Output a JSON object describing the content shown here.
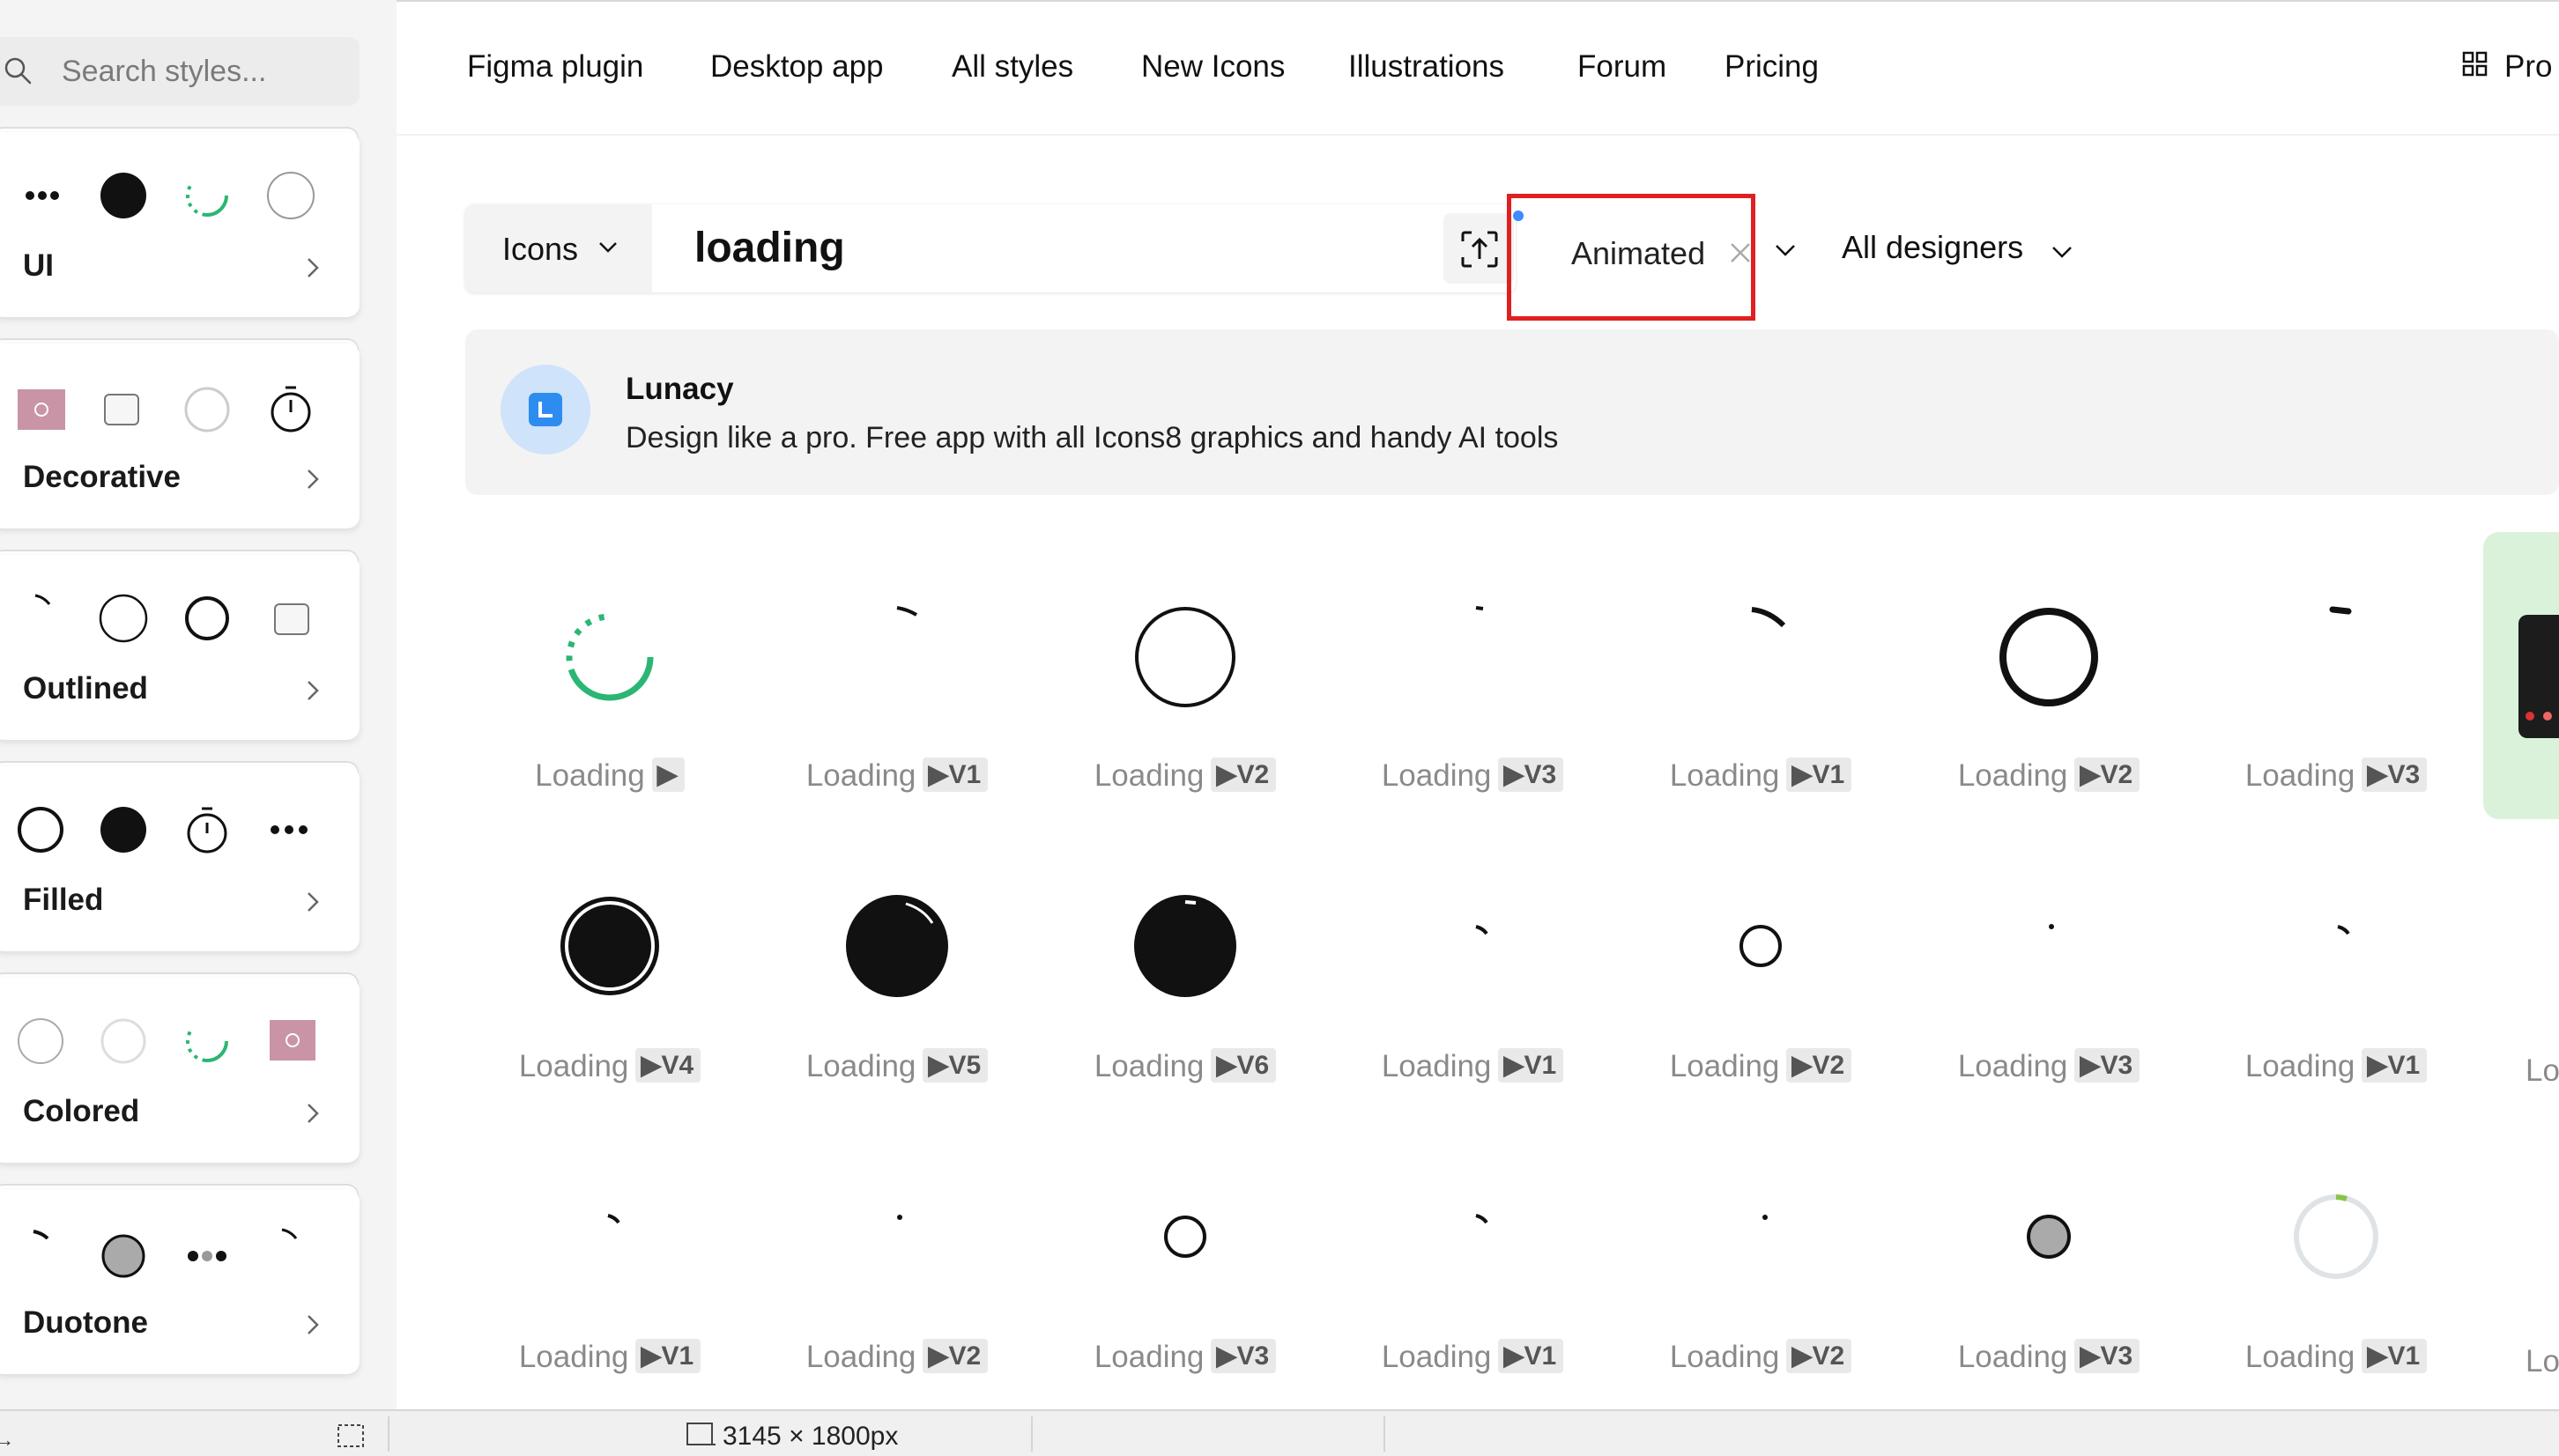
{
  "sidebar": {
    "search_placeholder": "Search styles...",
    "categories": [
      {
        "label": "UI"
      },
      {
        "label": "Decorative"
      },
      {
        "label": "Outlined"
      },
      {
        "label": "Filled"
      },
      {
        "label": "Colored"
      },
      {
        "label": "Duotone"
      }
    ]
  },
  "nav": {
    "items": [
      "Figma plugin",
      "Desktop app",
      "All styles",
      "New Icons",
      "Illustrations",
      "Forum",
      "Pricing"
    ],
    "right_label": "Pro"
  },
  "search": {
    "category": "Icons",
    "query": "loading",
    "filter_animated": "Animated",
    "filter_designers": "All designers"
  },
  "promo": {
    "title": "Lunacy",
    "subtitle": "Design like a pro. Free app with all Icons8 graphics and handy AI tools"
  },
  "results": {
    "label": "Loading",
    "rows": [
      [
        {
          "badge": "▶",
          "icon": "spinner-green-icon"
        },
        {
          "badge": "▶V1",
          "icon": "arc-small-icon"
        },
        {
          "badge": "▶V2",
          "icon": "circle-outline-large-icon"
        },
        {
          "badge": "▶V3",
          "icon": "dash-tiny-icon"
        },
        {
          "badge": "▶V1",
          "icon": "arc-thick-icon"
        },
        {
          "badge": "▶V2",
          "icon": "circle-bold-large-icon"
        },
        {
          "badge": "▶V3",
          "icon": "dash-bold-icon"
        }
      ],
      [
        {
          "badge": "▶V4",
          "icon": "filled-ring-icon"
        },
        {
          "badge": "▶V5",
          "icon": "filled-circle-arc-icon"
        },
        {
          "badge": "▶V6",
          "icon": "filled-circle-dot-icon"
        },
        {
          "badge": "▶V1",
          "icon": "arc-tiny-icon"
        },
        {
          "badge": "▶V2",
          "icon": "circle-outline-small-icon"
        },
        {
          "badge": "▶V3",
          "icon": "dot-icon"
        },
        {
          "badge": "▶V1",
          "icon": "arc-tiny-icon"
        }
      ],
      [
        {
          "badge": "▶V1",
          "icon": "arc-tiny-icon"
        },
        {
          "badge": "▶V2",
          "icon": "dot-icon"
        },
        {
          "badge": "▶V3",
          "icon": "circle-outline-small-icon"
        },
        {
          "badge": "▶V1",
          "icon": "arc-tiny-icon"
        },
        {
          "badge": "▶V2",
          "icon": "dot-icon"
        },
        {
          "badge": "▶V3",
          "icon": "gray-circle-icon"
        },
        {
          "badge": "▶V1",
          "icon": "gray-ring-icon"
        }
      ]
    ],
    "edge_label": "Lo"
  },
  "status_bar": {
    "dimensions": "3145 × 1800px"
  },
  "colors": {
    "accent_green": "#2bb673",
    "highlight_red": "#e02020",
    "badge_bg": "#e9e9e9"
  }
}
